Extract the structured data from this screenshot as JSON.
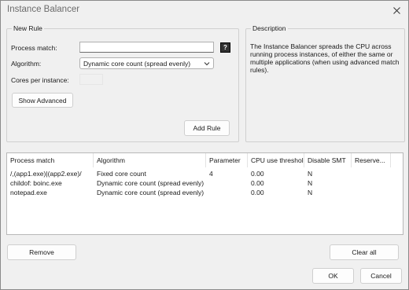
{
  "window": {
    "title": "Instance Balancer"
  },
  "new_rule": {
    "group_title": "New Rule",
    "process_match_label": "Process match:",
    "process_match_value": "",
    "help_icon": "?",
    "algorithm_label": "Algorithm:",
    "algorithm_selected": "Dynamic core count (spread evenly)",
    "cores_label": "Cores per instance:",
    "show_advanced_label": "Show Advanced",
    "add_rule_label": "Add Rule"
  },
  "description": {
    "group_title": "Description",
    "lines": [
      "The Instance Balancer spreads the CPU across",
      "running process instances, of either the same or",
      "multiple applications (when using advanced match",
      "rules)."
    ]
  },
  "rules_table": {
    "columns": [
      "Process match",
      "Algorithm",
      "Parameter",
      "CPU use threshold",
      "Disable SMT",
      "Reserve..."
    ],
    "rows": [
      [
        "/,(app1.exe)|(app2.exe)/",
        "Fixed core count",
        "4",
        "0.00",
        "N",
        ""
      ],
      [
        "childof: boinc.exe",
        "Dynamic core count (spread evenly)",
        "",
        "0.00",
        "N",
        ""
      ],
      [
        "notepad.exe",
        "Dynamic core count (spread evenly)",
        "",
        "0.00",
        "N",
        ""
      ]
    ]
  },
  "buttons": {
    "remove": "Remove",
    "clear_all": "Clear all",
    "ok": "OK",
    "cancel": "Cancel"
  }
}
